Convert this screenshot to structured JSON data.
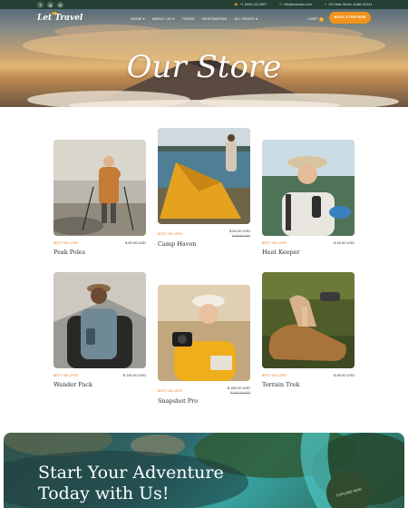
{
  "topbar": {
    "socials": [
      "f",
      "ig",
      "tk"
    ],
    "contact": [
      {
        "icon": "phone-icon",
        "text": "+1 (555) 123-4567"
      },
      {
        "icon": "mail-icon",
        "text": "info@example.com"
      },
      {
        "icon": "pin-icon",
        "text": "123 Main Street, Austin 62914"
      }
    ]
  },
  "nav": {
    "logo": "Let Travel",
    "items": [
      "HOME",
      "ABOUT US",
      "TOURS",
      "DESTINATION",
      "ALL PAGES"
    ],
    "cart_label": "CART",
    "cart_count": "0",
    "cta_label": "BOOK A TRIP NOW"
  },
  "hero": {
    "title": "Our Store"
  },
  "products": [
    {
      "name": "Peak Poles",
      "tag": "BEST SELLERS",
      "price": "$ 80.00 USD",
      "old_price": ""
    },
    {
      "name": "Camp Haven",
      "tag": "BEST SELLERS",
      "price": "$ 84.00 USD",
      "old_price": "$ 95.00 USD"
    },
    {
      "name": "Heat Keeper",
      "tag": "BEST SELLERS",
      "price": "$ 45.00 USD",
      "old_price": ""
    },
    {
      "name": "Wander Pack",
      "tag": "BEST SELLERS",
      "price": "$ 140.00 USD",
      "old_price": ""
    },
    {
      "name": "Snapshot Pro",
      "tag": "BEST SELLERS",
      "price": "$ 180.00 USD",
      "old_price": "$ 200.00 USD"
    },
    {
      "name": "Terrain Trek",
      "tag": "BEST SELLERS",
      "price": "$ 96.00 USD",
      "old_price": ""
    }
  ],
  "cta": {
    "title_line1": "Start Your Adventure",
    "title_line2": "Today with Us!",
    "explore_label": "EXPLORE NOW"
  },
  "colors": {
    "topbar": "#243f33",
    "accent": "#f2931b",
    "sale_tag": "#f07b1c",
    "text_dark": "#1f2d25"
  }
}
